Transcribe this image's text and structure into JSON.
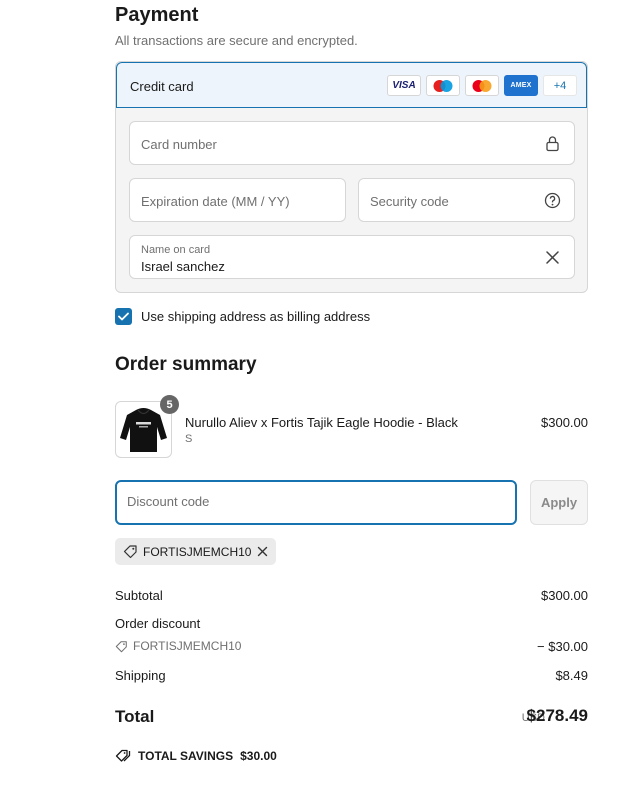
{
  "payment": {
    "title": "Payment",
    "subtitle": "All transactions are secure and encrypted.",
    "method_label": "Credit card",
    "card_brands": [
      "VISA",
      "maestro",
      "mastercard",
      "AMEX"
    ],
    "visa_label": "VISA",
    "amex_label": "AMEX",
    "more_brands": "+4",
    "card_number_placeholder": "Card number",
    "expiration_placeholder": "Expiration date (MM / YY)",
    "security_placeholder": "Security code",
    "name_label": "Name on card",
    "name_value": "Israel sanchez",
    "billing_checkbox_label": "Use shipping address as billing address",
    "billing_checked": true
  },
  "order": {
    "title": "Order summary",
    "item": {
      "quantity": "5",
      "name": "Nurullo Aliev x Fortis Tajik Eagle Hoodie - Black",
      "variant": "S",
      "price": "$300.00"
    },
    "discount_placeholder": "Discount code",
    "apply_label": "Apply",
    "applied_code": "FORTISJMEMCH10",
    "subtotal_label": "Subtotal",
    "subtotal_value": "$300.00",
    "order_discount_label": "Order discount",
    "discount_code": "FORTISJMEMCH10",
    "discount_value": "− $30.00",
    "shipping_label": "Shipping",
    "shipping_value": "$8.49",
    "total_label": "Total",
    "total_currency": "USD",
    "total_value": "$278.49",
    "savings_label": "TOTAL SAVINGS",
    "savings_value": "$30.00"
  },
  "colors": {
    "accent": "#1773b0",
    "field_border": "#d6d6d6",
    "muted_text": "#707070"
  }
}
